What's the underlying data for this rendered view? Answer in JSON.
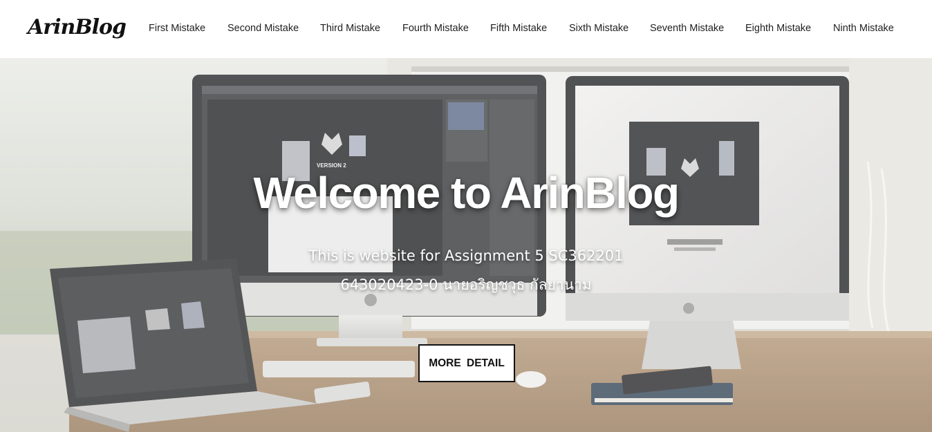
{
  "brand": {
    "logo_text": "ArinBlog"
  },
  "nav": {
    "items": [
      {
        "label": "First Mistake"
      },
      {
        "label": "Second Mistake"
      },
      {
        "label": "Third Mistake"
      },
      {
        "label": "Fourth Mistake"
      },
      {
        "label": "Fifth Mistake"
      },
      {
        "label": "Sixth Mistake"
      },
      {
        "label": "Seventh Mistake"
      },
      {
        "label": "Eighth Mistake"
      },
      {
        "label": "Ninth Mistake"
      }
    ]
  },
  "hero": {
    "title": "Welcome to ArinBlog",
    "subtitle_line1": "This is website for Assignment 5 SC362201",
    "subtitle_line2": "643020423-0 นายอริญชวุธ กัลยานาม",
    "button_label": "MORE DETAIL",
    "background_image": "desk-with-monitors-and-laptop-photo",
    "screen_graphic_text": "VERSION 2"
  },
  "colors": {
    "header_bg": "#ffffff",
    "nav_text": "#1f1f1f",
    "hero_text": "#ffffff",
    "button_border": "#111111",
    "button_bg": "#ffffff"
  }
}
